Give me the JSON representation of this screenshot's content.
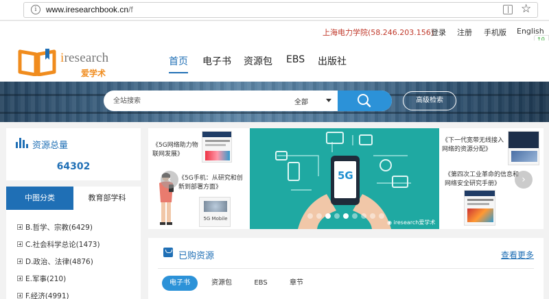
{
  "browser": {
    "url_host": "www.iresearchbook.cn",
    "url_path": "/f"
  },
  "toplinks": {
    "institution": "上海电力学院(58.246.203.156)",
    "login": "登录",
    "register": "注册",
    "mobile": "手机版",
    "english": "English"
  },
  "float_widget": {
    "up": "0",
    "down": "0"
  },
  "logo": {
    "brand_i": "i",
    "brand_rest": "research",
    "brand_cn": "爱学术"
  },
  "nav": [
    "首页",
    "电子书",
    "资源包",
    "EBS",
    "出版社"
  ],
  "search": {
    "placeholder": "全站搜索",
    "scope": "全部",
    "advanced": "高级检索"
  },
  "stats": {
    "title": "资源总量",
    "total": "64302"
  },
  "categories": {
    "tabs": [
      "中图分类",
      "教育部学科"
    ],
    "items": [
      "B.哲学、宗教(6429)",
      "C.社会科学总论(1473)",
      "D.政治、法律(4876)",
      "E.军事(210)",
      "F.经济(4991)"
    ]
  },
  "carousel": {
    "books": [
      "《5G网络助力物联网发展》",
      "《5G手机：从研究和创新到部署方面》",
      "《下一代宽带无线接入网络的资源分配》",
      "《第四次工业革命的信息和网络安全研究手册》"
    ],
    "center_label": "5G",
    "cover_text": "5G Mobile",
    "watermark": "iresearch爱学术",
    "prev": "‹",
    "next": "›"
  },
  "purchased": {
    "title": "已购资源",
    "more": "查看更多",
    "tabs": [
      "电子书",
      "资源包",
      "EBS",
      "章节"
    ]
  },
  "colors": {
    "primary": "#1f6fb5",
    "accent": "#2c92d8",
    "logo_orange": "#f08c1e",
    "institution_red": "#c0392b",
    "teal": "#1fa9a2"
  }
}
